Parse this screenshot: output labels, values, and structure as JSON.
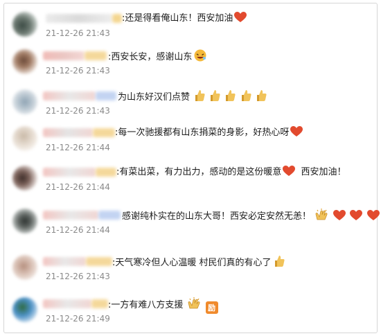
{
  "comments": [
    {
      "text": ":还是得看俺山东！西安加油",
      "time": "21-12-26 21:43",
      "emojis": [
        "heart"
      ]
    },
    {
      "text": ":西安长安，感谢山东",
      "time": "21-12-26 21:43",
      "emojis": [
        "laughing-face"
      ]
    },
    {
      "text": "为山东好汉们点赞",
      "time": "21-12-26 21:43",
      "emojis": [
        "thumbs-up",
        "thumbs-up",
        "thumbs-up",
        "thumbs-up",
        "thumbs-up"
      ]
    },
    {
      "text": ":每一次驰援都有山东捐菜的身影，好热心呀",
      "time": "21-12-26 21:44",
      "emojis": [
        "heart"
      ]
    },
    {
      "text": ":有菜出菜，有力出力，感动的是这份暖意",
      "text2": "西安加油！",
      "time": "21-12-26 21:44",
      "emojis": [
        "heart"
      ]
    },
    {
      "text": "感谢纯朴实在的山东大哥！西安必定安然无恙！",
      "time": "21-12-26 21:44",
      "emojis": [
        "clapping-hands",
        "heart",
        "heart",
        "heart"
      ]
    },
    {
      "text": ":天气寒冷但人心温暖 村民们真的有心了",
      "time": "21-12-26 21:43",
      "emojis": [
        "thumbs-up"
      ]
    },
    {
      "text": ":一方有难八方支援",
      "time": "21-12-26 21:49",
      "emojis": [
        "clapping-hands",
        "encourage"
      ]
    }
  ],
  "labels": {
    "encourage": "励"
  },
  "colors": {
    "heart": "#e24a2e",
    "thumb": "#e9b74a",
    "timestamp": "#8a8a8a"
  }
}
